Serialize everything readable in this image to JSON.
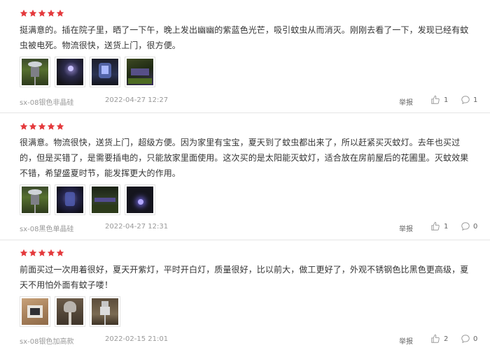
{
  "reviews": [
    {
      "rating": 5,
      "text": "挺满意的。插在院子里，晒了一下午，晚上发出幽幽的紫蓝色光芒，吸引蚊虫从而消灭。刚刚去看了一下，发现已经有蚊虫被电死。物流很快，送货上门，很方便。",
      "variant": "sx-08银色非晶硅",
      "date": "2022-04-27 12:27",
      "report_label": "举报",
      "likes": "1",
      "comments": "1"
    },
    {
      "rating": 5,
      "text": "很满意。物流很快，送货上门，超级方便。因为家里有宝宝，夏天到了蚊虫都出来了，所以赶紧买灭蚊灯。去年也买过的，但是买错了，是需要插电的，只能放家里面使用。这次买的是太阳能灭蚊灯，适合放在房前屋后的花圃里。灭蚊效果不错，希望盛夏时节，能发挥更大的作用。",
      "variant": "sx-08黑色单晶硅",
      "date": "2022-04-27 12:31",
      "report_label": "举报",
      "likes": "1",
      "comments": "0"
    },
    {
      "rating": 5,
      "text": "前面买过一次用着很好，夏天开紫灯，平时开白灯，质量很好，比以前大，做工更好了，外观不锈钢色比黑色更高级，夏天不用怕外面有蚊子喽！",
      "variant": "sx-08银色加高款",
      "date": "2022-02-15 21:01",
      "report_label": "举报",
      "likes": "2",
      "comments": "0"
    }
  ],
  "colors": {
    "star": "#e4393c",
    "meta": "#999999",
    "divider": "#e5e5e5"
  },
  "icons": {
    "star": "star-icon",
    "like": "thumbs-up-icon",
    "comment": "comment-bubble-icon"
  }
}
